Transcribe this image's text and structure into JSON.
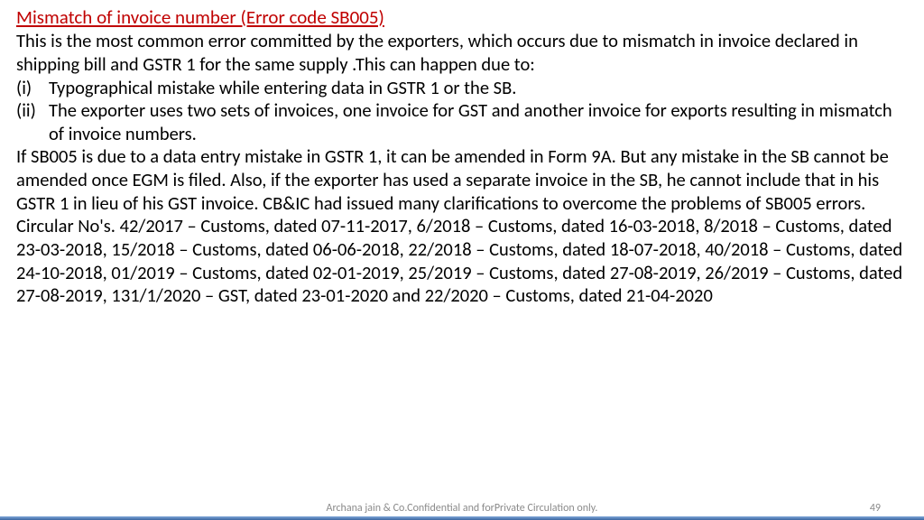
{
  "title": "Mismatch of invoice number (Error code SB005)",
  "intro": "This is the most common error committed by the exporters, which occurs due to mismatch in invoice declared in shipping bill and GSTR 1 for the same supply .This can happen due to:",
  "items": [
    {
      "marker": "(i)",
      "text": "Typographical mistake while entering data in GSTR 1 or the SB."
    },
    {
      "marker": "(ii)",
      "text": "The exporter uses two sets of invoices, one invoice for GST and another invoice for exports resulting in mismatch of invoice numbers."
    }
  ],
  "para": "If SB005 is due to a data entry mistake in GSTR 1, it can be amended in Form 9A. But any mistake in the SB cannot be amended once EGM is filed. Also, if the exporter has used a separate invoice in the SB, he cannot include that in his GSTR 1 in lieu of his GST invoice. CB&IC had issued many clarifications to overcome the problems of SB005 errors. Circular No's. 42/2017 – Customs, dated 07-11-2017, 6/2018 – Customs, dated 16-03-2018, 8/2018 – Customs, dated 23-03-2018, 15/2018 – Customs, dated 06-06-2018, 22/2018 – Customs, dated 18-07-2018, 40/2018 – Customs, dated 24-10-2018, 01/2019 – Customs, dated 02-01-2019, 25/2019 – Customs, dated 27-08-2019, 26/2019 – Customs, dated 27-08-2019, 131/1/2020 – GST, dated 23-01-2020 and 22/2020 – Customs, dated 21-04-2020",
  "footer": "Archana jain & Co.Confidential and forPrivate Circulation only.",
  "page": "49"
}
